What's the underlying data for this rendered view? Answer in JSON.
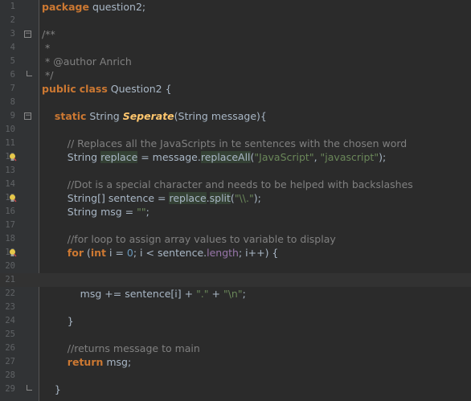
{
  "editor": {
    "lines": [
      {
        "num": "1",
        "text": "package question2;"
      },
      {
        "num": "2",
        "text": ""
      },
      {
        "num": "3",
        "text": "/**"
      },
      {
        "num": "4",
        "text": " *"
      },
      {
        "num": "5",
        "text": " * @author Anrich"
      },
      {
        "num": "6",
        "text": " */"
      },
      {
        "num": "7",
        "text": "public class Question2 {"
      },
      {
        "num": "8",
        "text": ""
      },
      {
        "num": "9",
        "text": "    static String Seperate(String message){"
      },
      {
        "num": "10",
        "text": ""
      },
      {
        "num": "11",
        "text": "        // Replaces all the JavaScripts in te sentences with the chosen word"
      },
      {
        "num": "12",
        "text": "        String replace = message.replaceAll(\"JavaScript\", \"javascript\");"
      },
      {
        "num": "13",
        "text": ""
      },
      {
        "num": "14",
        "text": "        //Dot is a special character and needs to be helped with backslashes"
      },
      {
        "num": "15",
        "text": "        String[] sentence = replace.split(\"\\\\.\");"
      },
      {
        "num": "16",
        "text": "        String msg = \"\";"
      },
      {
        "num": "17",
        "text": ""
      },
      {
        "num": "18",
        "text": "        //for loop to assign array values to variable to display"
      },
      {
        "num": "19",
        "text": "        for (int i = 0; i < sentence.length; i++) {"
      },
      {
        "num": "20",
        "text": ""
      },
      {
        "num": "21",
        "text": ""
      },
      {
        "num": "22",
        "text": "            msg += sentence[i] + \".\" + \"\\n\";"
      },
      {
        "num": "23",
        "text": ""
      },
      {
        "num": "24",
        "text": "        }"
      },
      {
        "num": "25",
        "text": ""
      },
      {
        "num": "26",
        "text": "        //returns message to main"
      },
      {
        "num": "27",
        "text": "        return msg;"
      },
      {
        "num": "28",
        "text": ""
      },
      {
        "num": "29",
        "text": "    }"
      }
    ],
    "gutter_icons": {
      "fold_open_lines": [
        "3",
        "9"
      ],
      "fold_end_lines": [
        "6",
        "29"
      ],
      "bulb_lines": [
        "12",
        "15",
        "19"
      ]
    },
    "current_line": "21",
    "colors": {
      "background": "#2b2b2b",
      "gutter": "#313335",
      "keyword": "#cc7832",
      "method": "#ffc66d",
      "comment": "#808080",
      "string": "#6a8759",
      "number": "#6897bb",
      "field": "#9876aa",
      "plain": "#a9b7c6"
    }
  }
}
